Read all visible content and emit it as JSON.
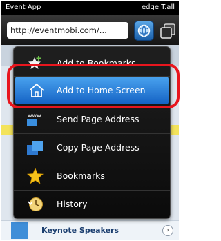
{
  "status_bar": {
    "app_name": "Event App",
    "network": "edge T.all"
  },
  "browser": {
    "url": "http://eventmobi.com/..."
  },
  "menu": {
    "items": [
      {
        "label": "Add to Bookmarks",
        "icon": "star-add-icon"
      },
      {
        "label": "Add to Home Screen",
        "icon": "home-icon",
        "selected": true
      },
      {
        "label": "Send Page Address",
        "icon": "www-icon"
      },
      {
        "label": "Copy Page Address",
        "icon": "copy-icon"
      },
      {
        "label": "Bookmarks",
        "icon": "star-icon"
      },
      {
        "label": "History",
        "icon": "history-icon"
      }
    ]
  },
  "page": {
    "row_label": "Keynote Speakers",
    "chevron": "›"
  },
  "colors": {
    "selected": "#2a7fd8",
    "highlight": "#e8161e",
    "menu_bg": "#141414"
  }
}
